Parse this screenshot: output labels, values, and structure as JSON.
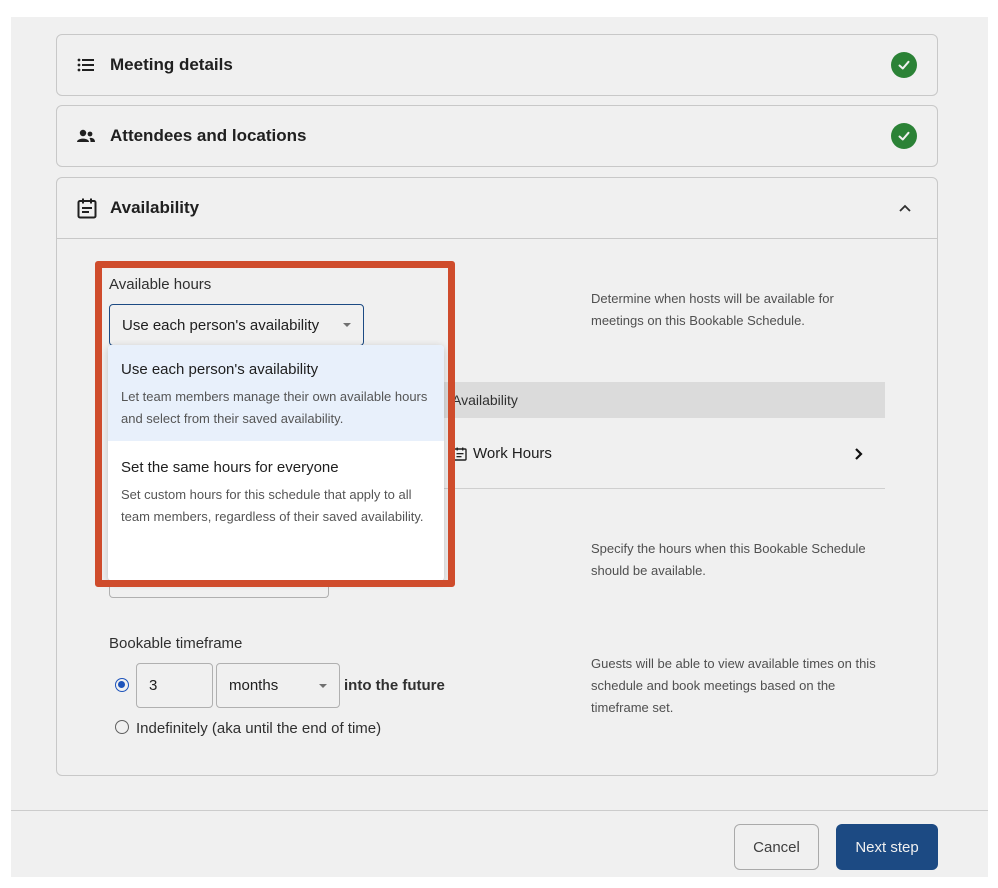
{
  "sections": {
    "meeting_details": {
      "title": "Meeting details",
      "icon": "list-icon",
      "status": "complete"
    },
    "attendees": {
      "title": "Attendees and locations",
      "icon": "people-icon",
      "status": "complete"
    },
    "availability": {
      "title": "Availability",
      "icon": "calendar-icon",
      "expanded": true
    }
  },
  "available_hours": {
    "label": "Available hours",
    "selected": "Use each person's availability",
    "help": "Determine when hosts will be available for meetings on this Bookable Schedule."
  },
  "dropdown": {
    "options": [
      {
        "title": "Use each person's availability",
        "desc": "Let team members manage their own available hours and select from their saved availability.",
        "selected": true
      },
      {
        "title": "Set the same hours for everyone",
        "desc": "Set custom hours for this schedule that apply to all team members, regardless of their saved availability.",
        "selected": false
      }
    ]
  },
  "availability_table": {
    "header": "Availability",
    "row": "Work Hours"
  },
  "schedule_hours": {
    "help": "Specify the hours when this Bookable Schedule should be available."
  },
  "timeframe": {
    "label": "Bookable timeframe",
    "value": "3",
    "unit": "months",
    "suffix": "into the future",
    "indefinitely_label": "Indefinitely (aka until the end of time)",
    "help": "Guests will be able to view available times on this schedule and book meetings based on the timeframe set."
  },
  "footer": {
    "cancel": "Cancel",
    "next": "Next step"
  },
  "colors": {
    "accent": "#1e4f8c",
    "success": "#2e8b3a",
    "highlight": "#cf4c2c"
  }
}
